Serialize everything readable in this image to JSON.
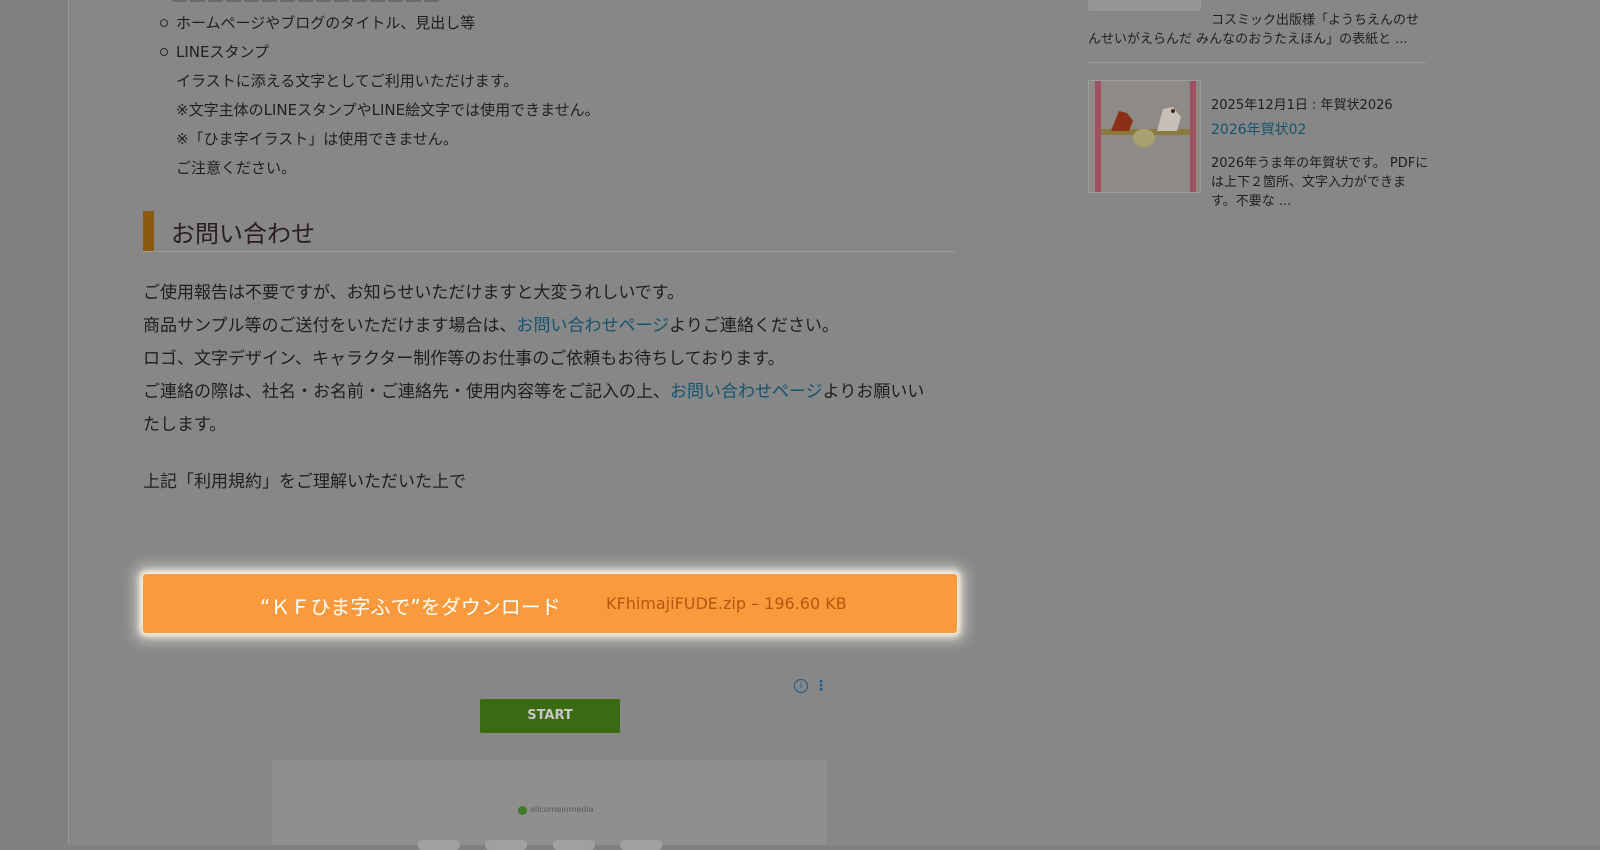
{
  "main": {
    "list": {
      "item1": "ホームページやブログのタイトル、見出し等",
      "item2": "LINEスタンプ",
      "item2_note1": "イラストに添える文字としてご利用いただけます。",
      "item2_note2": "※文字主体のLINEスタンプやLINE絵文字では使用できません。",
      "item2_note3": "※「ひま字イラスト」は使用できません。",
      "item2_note4": "ご注意ください。"
    },
    "contact": {
      "heading": "お問い合わせ",
      "p1": "ご使用報告は不要ですが、お知らせいただけますと大変うれしいです。",
      "p2_pre": "商品サンプル等のご送付をいただけます場合は、",
      "p2_link": "お問い合わせページ",
      "p2_post": "よりご連絡ください。",
      "p3": "ロゴ、文字デザイン、キャラクター制作等のお仕事のご依頼もお待ちしております。",
      "p4_pre": "ご連絡の際は、社名・お名前・ご連絡先・使用内容等をご記入の上、",
      "p4_link": "お問い合わせページ",
      "p4_post": "よりお願いい",
      "p4_cont": "たします。",
      "p5": "上記「利用規約」をご理解いただいた上で"
    },
    "download": {
      "label": "“ＫＦひま字ふで”をダウンロード",
      "meta": "KFhimajiFUDE.zip – 196.60 KB"
    },
    "ad": {
      "info_icon": "i",
      "start_label": "START",
      "logo_text": "allcomeinmedia"
    }
  },
  "sidebar": {
    "post1": {
      "excerpt_line1": "コスミック出版様「ようちえんのせ",
      "excerpt_line2": "んせいがえらんだ みんなのおうたえほん」の表紙と ..."
    },
    "post2": {
      "meta": "2025年12月1日 : 年賀状2026",
      "title": "2026年賀状02",
      "excerpt_line1": "2026年うま年の年賀状です。 PDFに",
      "excerpt_line2": "は上下２箇所、文字入力ができま",
      "excerpt_line3": "す。不要な ..."
    }
  },
  "colors": {
    "overlay_bg": "#808080",
    "download_button": "#fa9a3c",
    "link": "#15546e",
    "heading_accent": "#8a5a12",
    "ad_start": "#3a6a12"
  }
}
